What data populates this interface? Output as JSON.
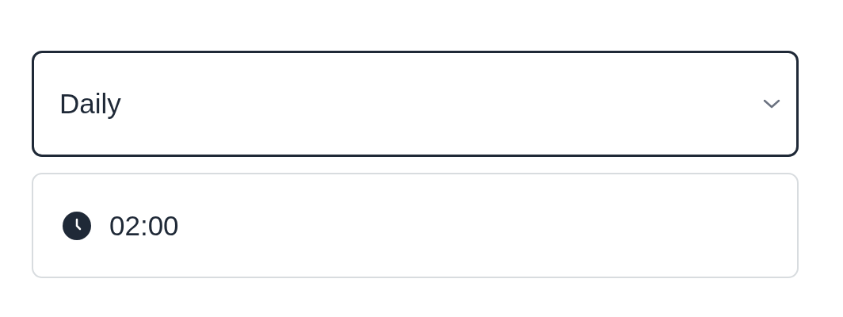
{
  "frequency_select": {
    "value": "Daily"
  },
  "time_field": {
    "value": "02:00"
  }
}
